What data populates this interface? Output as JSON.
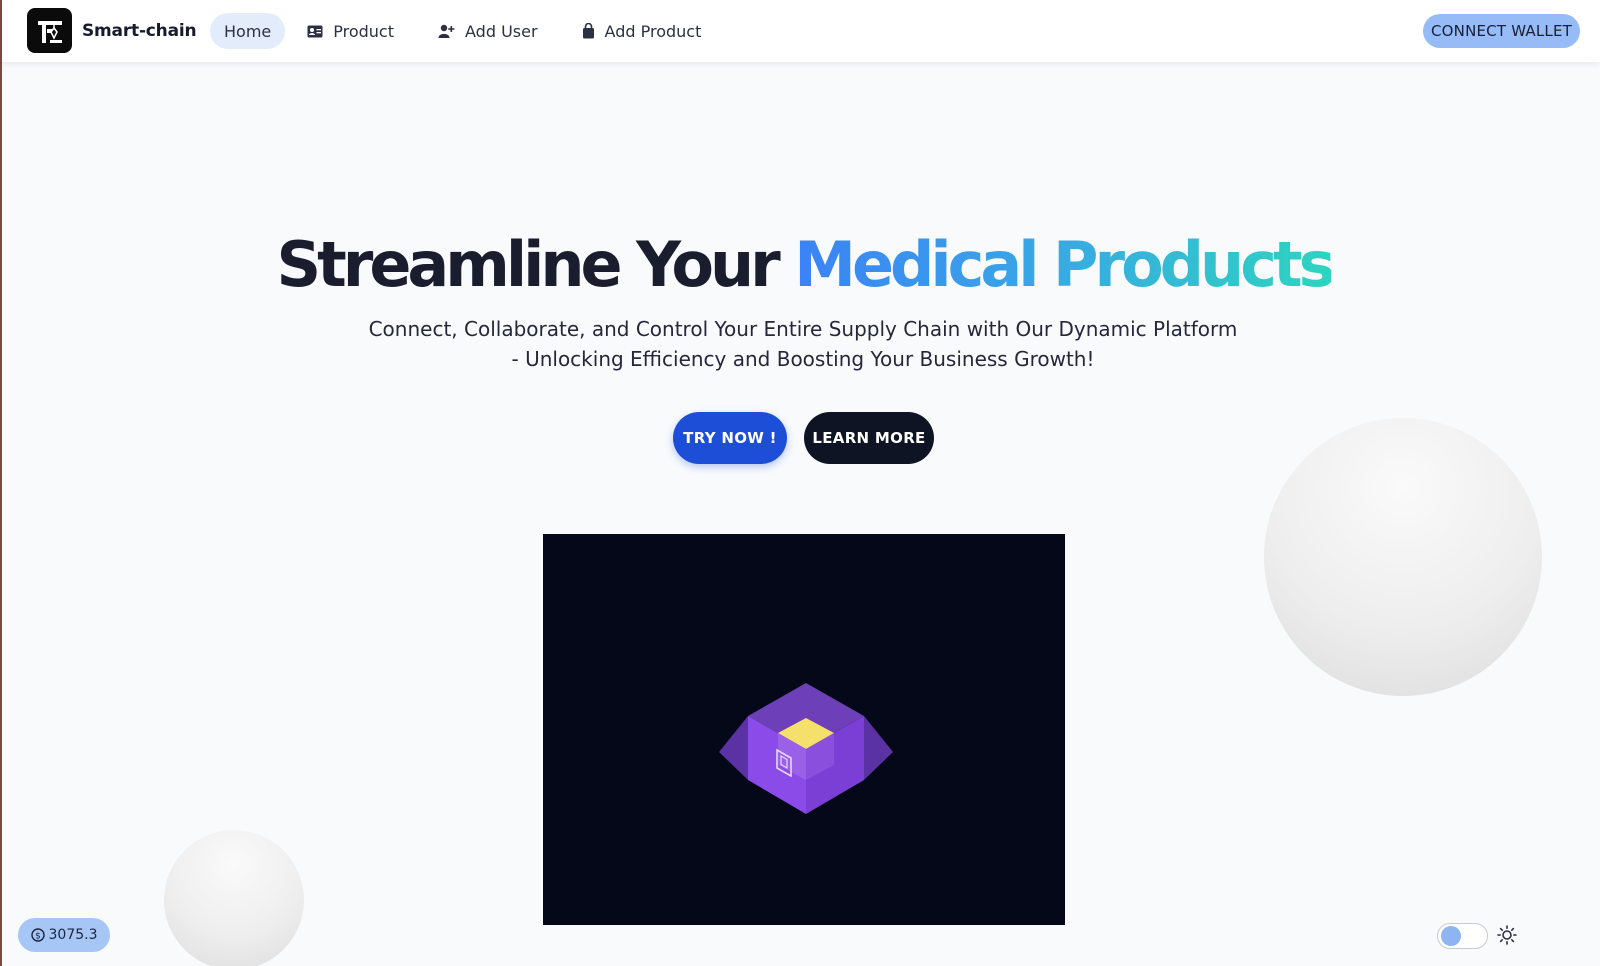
{
  "brand": {
    "name": "Smart-chain",
    "logo_icon": "crane-chain-logo"
  },
  "nav": {
    "items": [
      {
        "label": "Home",
        "icon": "",
        "active": true
      },
      {
        "label": "Product",
        "icon": "id-card-icon",
        "active": false
      },
      {
        "label": "Add User",
        "icon": "user-plus-icon",
        "active": false
      },
      {
        "label": "Add Product",
        "icon": "shopping-bag-icon",
        "active": false
      }
    ],
    "connect_label": "CONNECT WALLET"
  },
  "hero": {
    "title_part1": "Streamline Your ",
    "title_highlight": "Medical Products",
    "subtitle_line1": "Connect, Collaborate, and Control Your Entire Supply Chain with Our Dynamic Platform",
    "subtitle_line2": "- Unlocking Efficiency and Boosting Your Business Growth!",
    "try_label": "TRY NOW !",
    "learn_label": "LEARN MORE"
  },
  "balance": {
    "value": "3075.3",
    "icon": "dollar-circle-icon"
  },
  "theme": {
    "toggle_on": false,
    "icon": "sun-icon"
  },
  "colors": {
    "accent_blue": "#1d4ed8",
    "gradient_start": "#3b82f6",
    "gradient_end": "#2dd4bf",
    "dark": "#0f1424",
    "wallet_button": "#96bbf6",
    "video_bg": "#050818"
  }
}
